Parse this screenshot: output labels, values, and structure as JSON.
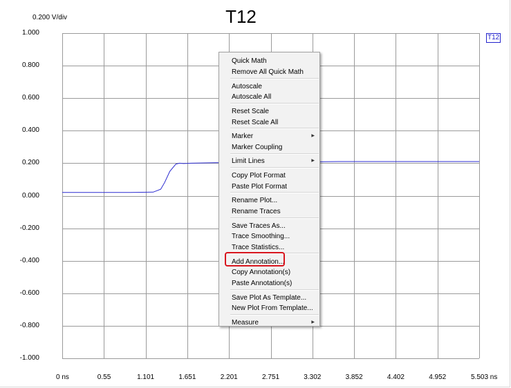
{
  "plot": {
    "title": "T12",
    "scale_label": "0.200 V/div",
    "trace_tag": "T12",
    "trace_color": "#2a2ad0",
    "y_ticks": [
      "1.000",
      "0.800",
      "0.600",
      "0.400",
      "0.200",
      "0.000",
      "-0.200",
      "-0.400",
      "-0.600",
      "-0.800",
      "-1.000"
    ],
    "x_ticks": [
      "0 ns",
      "0.55",
      "1.101",
      "1.651",
      "2.201",
      "2.751",
      "3.302",
      "3.852",
      "4.402",
      "4.952",
      "5.503 ns"
    ]
  },
  "chart_data": {
    "type": "line",
    "title": "T12",
    "xlabel": "",
    "ylabel": "",
    "x_unit": "ns",
    "y_unit": "V",
    "xlim": [
      0,
      5.503
    ],
    "ylim": [
      -1.0,
      1.0
    ],
    "grid": true,
    "series": [
      {
        "name": "T12",
        "x": [
          0,
          0.55,
          0.9,
          1.2,
          1.3,
          1.35,
          1.42,
          1.5,
          1.55,
          1.6,
          1.7,
          2.0,
          3.0,
          3.65,
          4.4,
          5.503
        ],
        "y": [
          0.02,
          0.02,
          0.02,
          0.022,
          0.04,
          0.08,
          0.15,
          0.195,
          0.2,
          0.198,
          0.2,
          0.203,
          0.207,
          0.21,
          0.21,
          0.21
        ]
      }
    ]
  },
  "menu": {
    "groups": [
      [
        "Quick Math",
        "Remove All Quick Math"
      ],
      [
        "Autoscale",
        "Autoscale All"
      ],
      [
        "Reset Scale",
        "Reset Scale All"
      ],
      [
        "Marker",
        "Marker Coupling"
      ],
      [
        "Limit Lines"
      ],
      [
        "Copy Plot Format",
        "Paste Plot Format"
      ],
      [
        "Rename Plot...",
        "Rename Traces"
      ],
      [
        "Save Traces As...",
        "Trace Smoothing...",
        "Trace Statistics..."
      ],
      [
        "Add Annotation...",
        "Copy Annotation(s)",
        "Paste Annotation(s)"
      ],
      [
        "Save Plot As Template...",
        "New Plot From Template..."
      ],
      [
        "Measure"
      ]
    ],
    "submenu_items": [
      "Marker",
      "Limit Lines",
      "Measure"
    ],
    "highlighted_item": "Add Annotation...",
    "highlight_color": "#d8141d"
  }
}
